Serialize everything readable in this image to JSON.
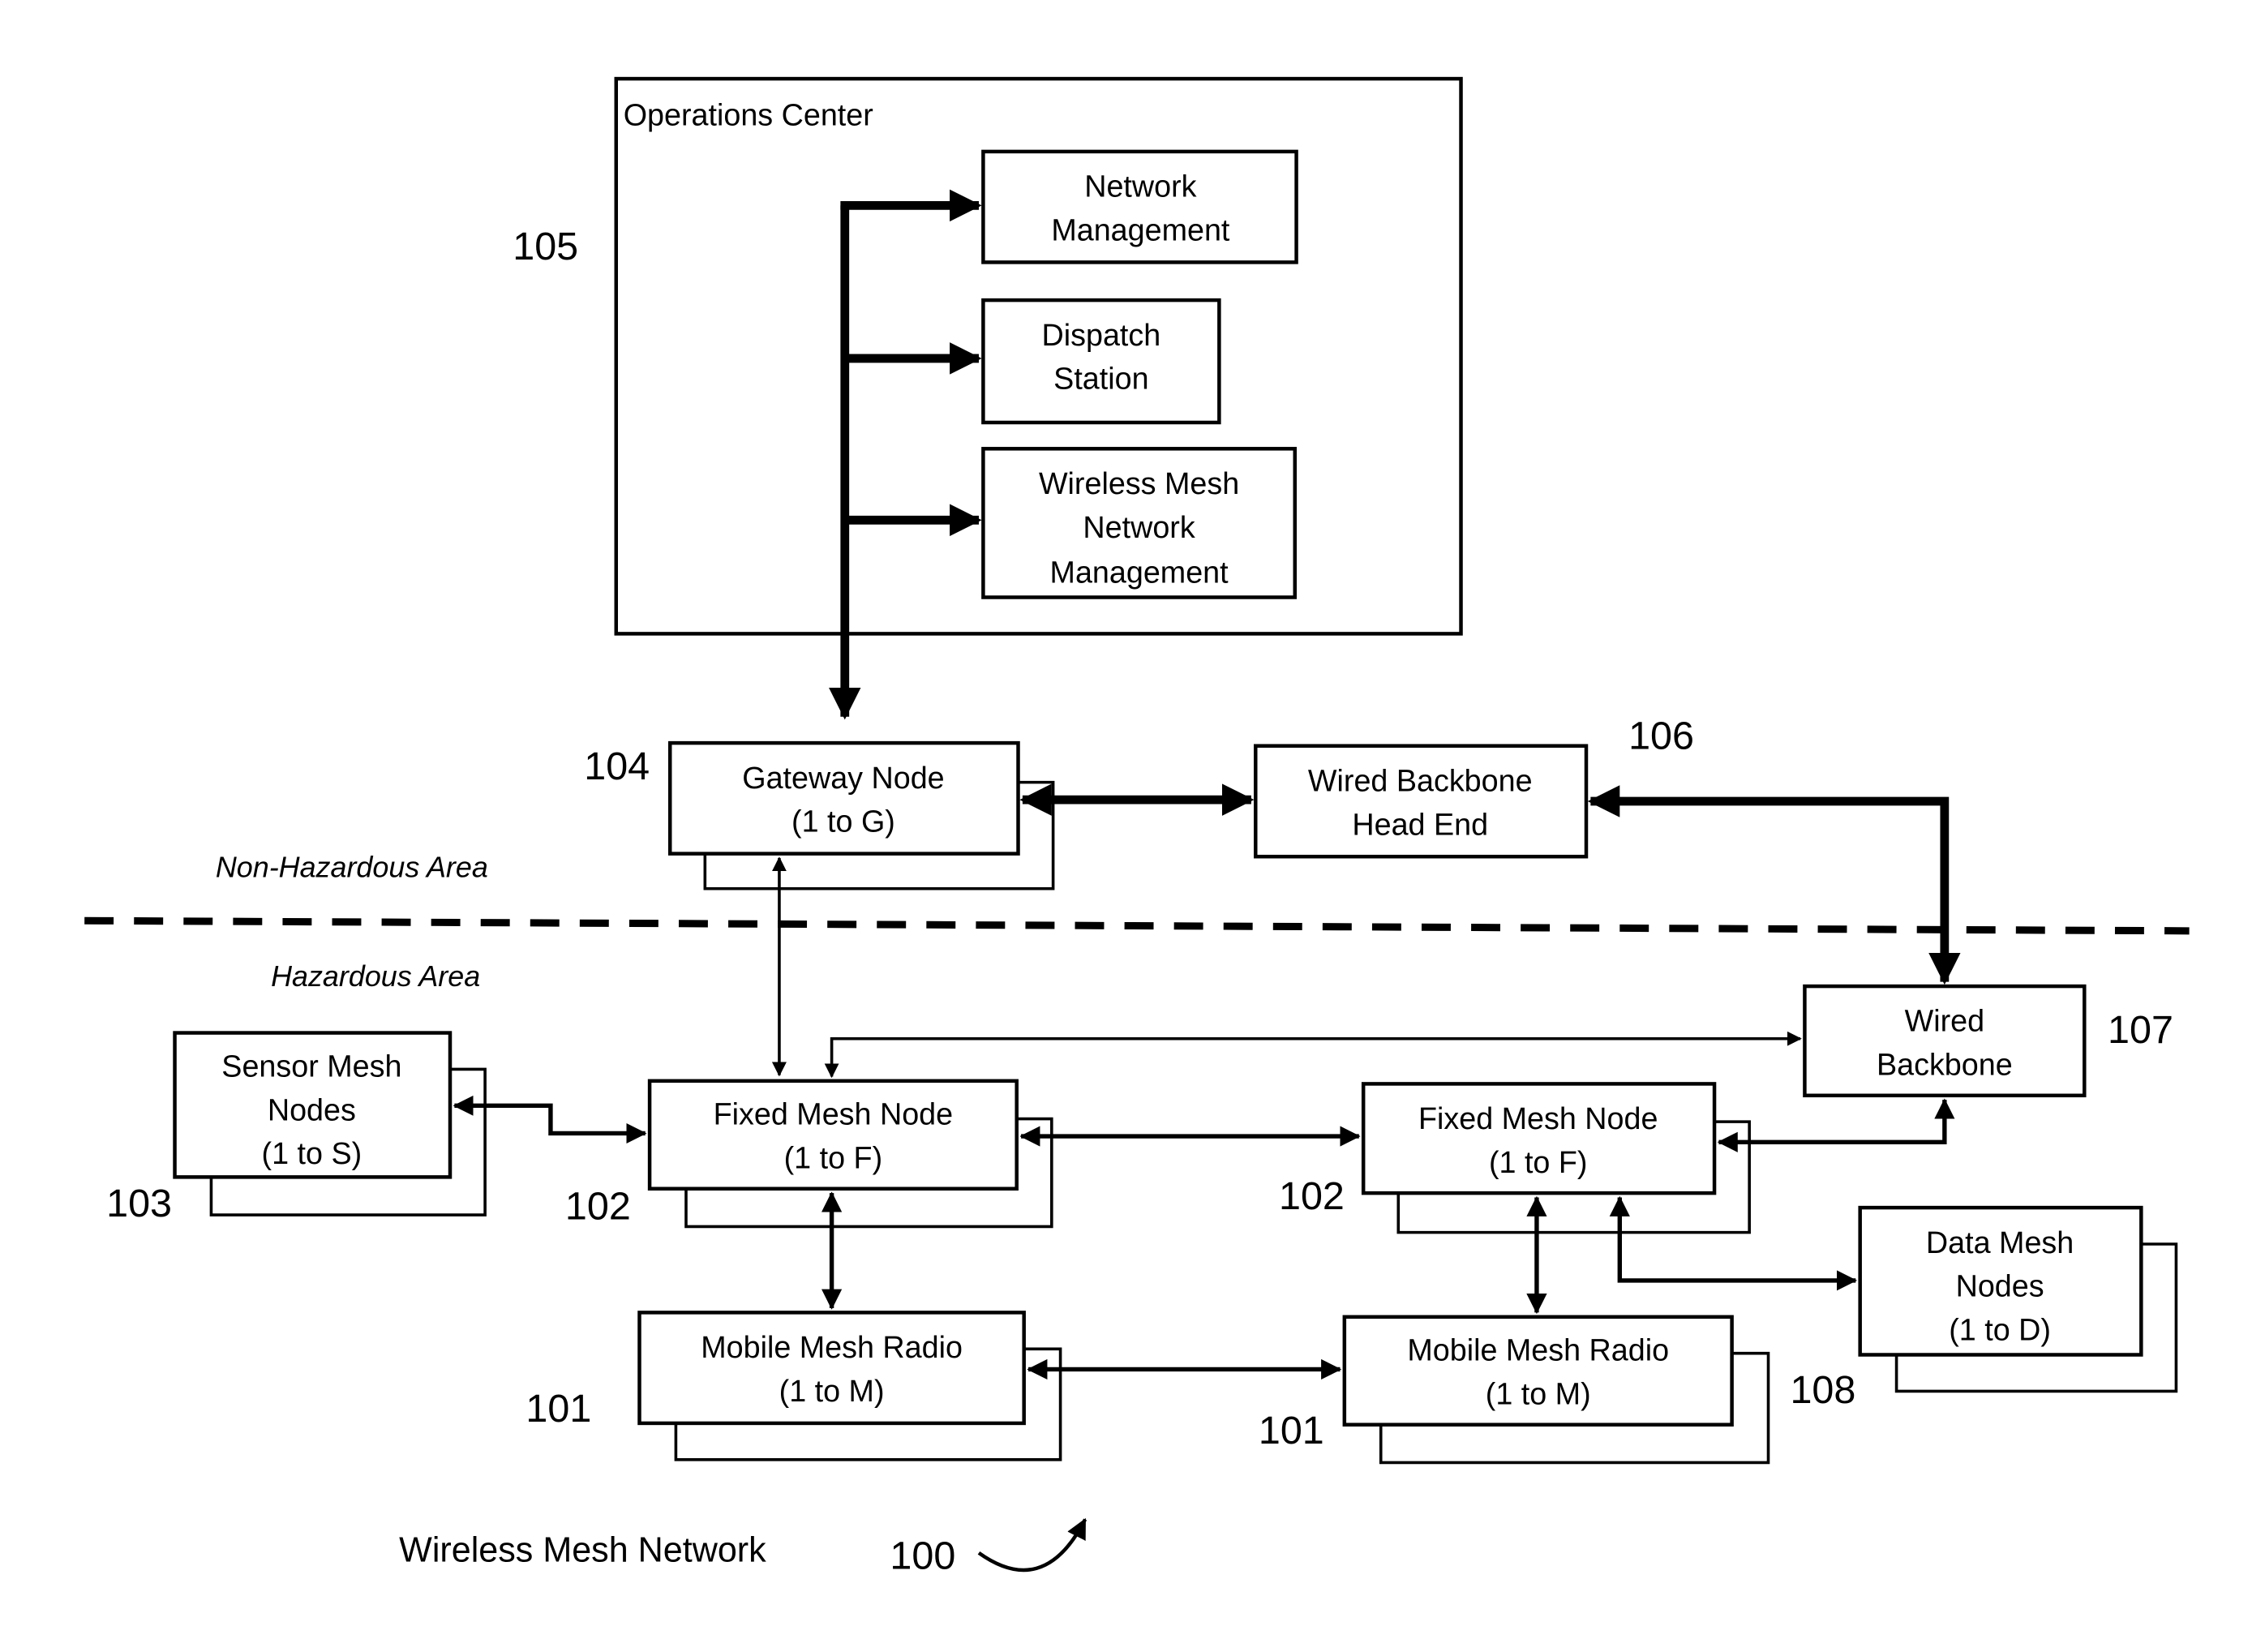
{
  "title": "Wireless Mesh Network",
  "figure_ref": "100",
  "areas": {
    "non_hazardous": "Non-Hazardous Area",
    "hazardous": "Hazardous Area"
  },
  "operations_center": {
    "label": "Operations Center",
    "ref": "105",
    "network_management": [
      "Network",
      "Management"
    ],
    "dispatch_station": [
      "Dispatch",
      "Station"
    ],
    "wireless_mesh_network_management": [
      "Wireless Mesh",
      "Network",
      "Management"
    ]
  },
  "gateway_node": {
    "lines": [
      "Gateway Node",
      "(1 to G)"
    ],
    "ref": "104"
  },
  "wired_backbone_head_end": {
    "lines": [
      "Wired Backbone",
      "Head End"
    ],
    "ref": "106"
  },
  "wired_backbone": {
    "lines": [
      "Wired",
      "Backbone"
    ],
    "ref": "107"
  },
  "sensor_mesh_nodes": {
    "lines": [
      "Sensor Mesh",
      "Nodes",
      "(1 to S)"
    ],
    "ref": "103"
  },
  "fixed_mesh_node_left": {
    "lines": [
      "Fixed Mesh Node",
      "(1 to F)"
    ],
    "ref": "102"
  },
  "fixed_mesh_node_right": {
    "lines": [
      "Fixed Mesh Node",
      "(1 to F)"
    ],
    "ref": "102"
  },
  "mobile_mesh_radio_left": {
    "lines": [
      "Mobile Mesh Radio",
      "(1 to M)"
    ],
    "ref": "101"
  },
  "mobile_mesh_radio_right": {
    "lines": [
      "Mobile Mesh Radio",
      "(1 to M)"
    ],
    "ref": "101"
  },
  "data_mesh_nodes": {
    "lines": [
      "Data Mesh",
      "Nodes",
      "(1 to D)"
    ],
    "ref": "108"
  }
}
